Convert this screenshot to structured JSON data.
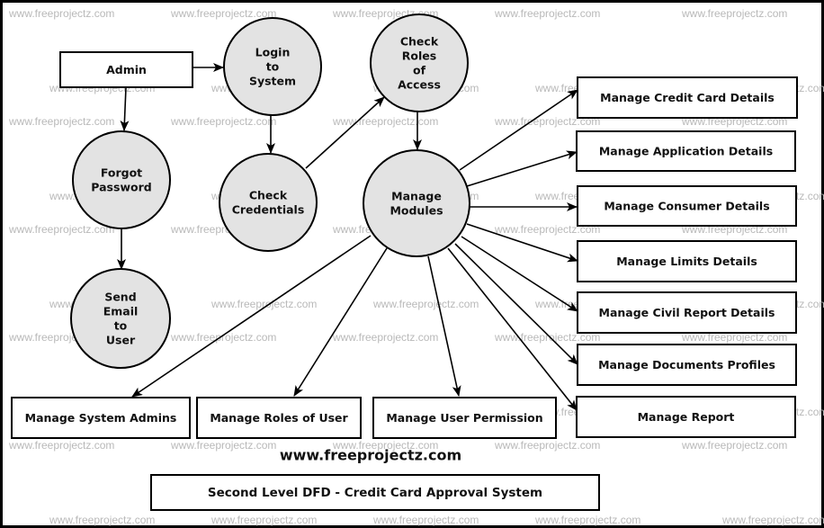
{
  "diagram": {
    "type": "data-flow-diagram",
    "level": "Second Level",
    "watermark_text": "www.freeprojectz.com",
    "site_label": "www.freeprojectz.com",
    "title": "Second Level DFD - Credit Card Approval System",
    "colors": {
      "process_fill": "#e3e3e3",
      "stroke": "#000000",
      "watermark": "#b9b9b9",
      "background": "#ffffff"
    },
    "entities": [
      {
        "id": "admin",
        "label": "Admin"
      },
      {
        "id": "credit_card",
        "label": "Manage Credit Card Details"
      },
      {
        "id": "application",
        "label": "Manage Application Details"
      },
      {
        "id": "consumer",
        "label": "Manage Consumer Details"
      },
      {
        "id": "limits",
        "label": "Manage Limits Details"
      },
      {
        "id": "civil_report",
        "label": "Manage Civil Report Details"
      },
      {
        "id": "documents",
        "label": "Manage Documents Profiles"
      },
      {
        "id": "report",
        "label": "Manage Report"
      },
      {
        "id": "system_admins",
        "label": "Manage System Admins"
      },
      {
        "id": "roles_user",
        "label": "Manage Roles of User"
      },
      {
        "id": "user_permission",
        "label": "Manage User Permission"
      }
    ],
    "processes": [
      {
        "id": "login",
        "label_lines": [
          "Login",
          "to",
          "System"
        ]
      },
      {
        "id": "check_roles",
        "label_lines": [
          "Check",
          "Roles",
          "of",
          "Access"
        ]
      },
      {
        "id": "forgot",
        "label_lines": [
          "Forgot",
          "Password"
        ]
      },
      {
        "id": "check_cred",
        "label_lines": [
          "Check",
          "Credentials"
        ]
      },
      {
        "id": "manage_modules",
        "label_lines": [
          "Manage",
          "Modules"
        ]
      },
      {
        "id": "send_email",
        "label_lines": [
          "Send",
          "Email",
          "to",
          "User"
        ]
      }
    ],
    "flows": [
      {
        "from": "admin",
        "to": "login"
      },
      {
        "from": "admin",
        "to": "forgot"
      },
      {
        "from": "forgot",
        "to": "send_email"
      },
      {
        "from": "login",
        "to": "check_cred"
      },
      {
        "from": "check_cred",
        "to": "check_roles"
      },
      {
        "from": "check_roles",
        "to": "manage_modules"
      },
      {
        "from": "manage_modules",
        "to": "credit_card"
      },
      {
        "from": "manage_modules",
        "to": "application"
      },
      {
        "from": "manage_modules",
        "to": "consumer"
      },
      {
        "from": "manage_modules",
        "to": "limits"
      },
      {
        "from": "manage_modules",
        "to": "civil_report"
      },
      {
        "from": "manage_modules",
        "to": "documents"
      },
      {
        "from": "manage_modules",
        "to": "report"
      },
      {
        "from": "manage_modules",
        "to": "system_admins"
      },
      {
        "from": "manage_modules",
        "to": "roles_user"
      },
      {
        "from": "manage_modules",
        "to": "user_permission"
      }
    ]
  }
}
